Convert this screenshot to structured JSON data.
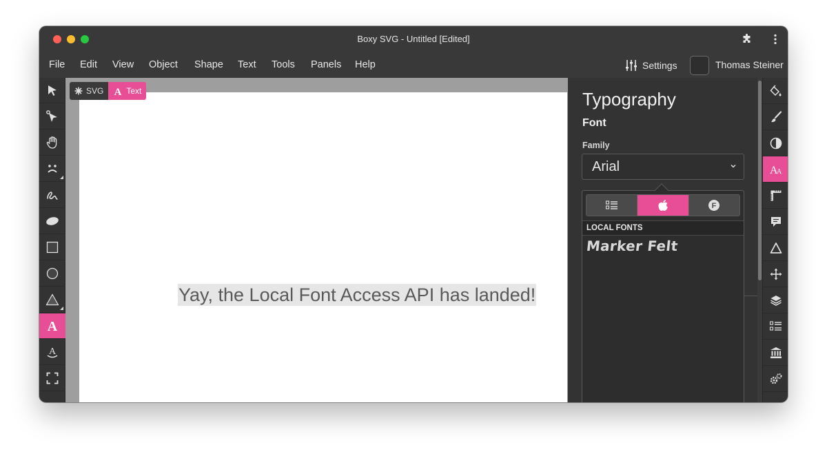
{
  "window": {
    "title": "Boxy SVG - Untitled [Edited]"
  },
  "menubar": {
    "items": [
      "File",
      "Edit",
      "View",
      "Object",
      "Shape",
      "Text",
      "Tools",
      "Panels",
      "Help"
    ],
    "settings_label": "Settings",
    "user_name": "Thomas Steiner"
  },
  "left_toolbar": {
    "tools": [
      "transform-tool",
      "edit-tool",
      "pan-tool",
      "symbol-tool",
      "freehand-tool",
      "blob-tool",
      "rect-tool",
      "ellipse-tool",
      "triangle-tool",
      "text-tool",
      "text-path-tool",
      "crop-tool"
    ],
    "active": "text-tool"
  },
  "canvas": {
    "breadcrumbs": [
      {
        "label": "SVG",
        "active": false
      },
      {
        "label": "Text",
        "active": true
      }
    ],
    "text": "Yay, the Local Font Access API has landed!"
  },
  "panel": {
    "title": "Typography",
    "section": "Font",
    "family_label": "Family",
    "family_value": "Arial",
    "popup": {
      "tabs": [
        "list",
        "local",
        "google"
      ],
      "active_tab": "local",
      "list_header": "LOCAL FONTS",
      "fonts": [
        "Marker Felt"
      ]
    }
  },
  "right_toolbar": {
    "panels": [
      "fill-panel",
      "stroke-panel",
      "compositing-panel",
      "typography-panel",
      "geometry-panel",
      "meta-panel",
      "defs-panel",
      "transform-panel",
      "arrangement-panel",
      "elements-panel",
      "library-panel",
      "generators-panel"
    ],
    "active": "typography-panel"
  },
  "colors": {
    "accent": "#e84e96",
    "chrome": "#333333",
    "canvas_bg": "#9e9e9e"
  }
}
